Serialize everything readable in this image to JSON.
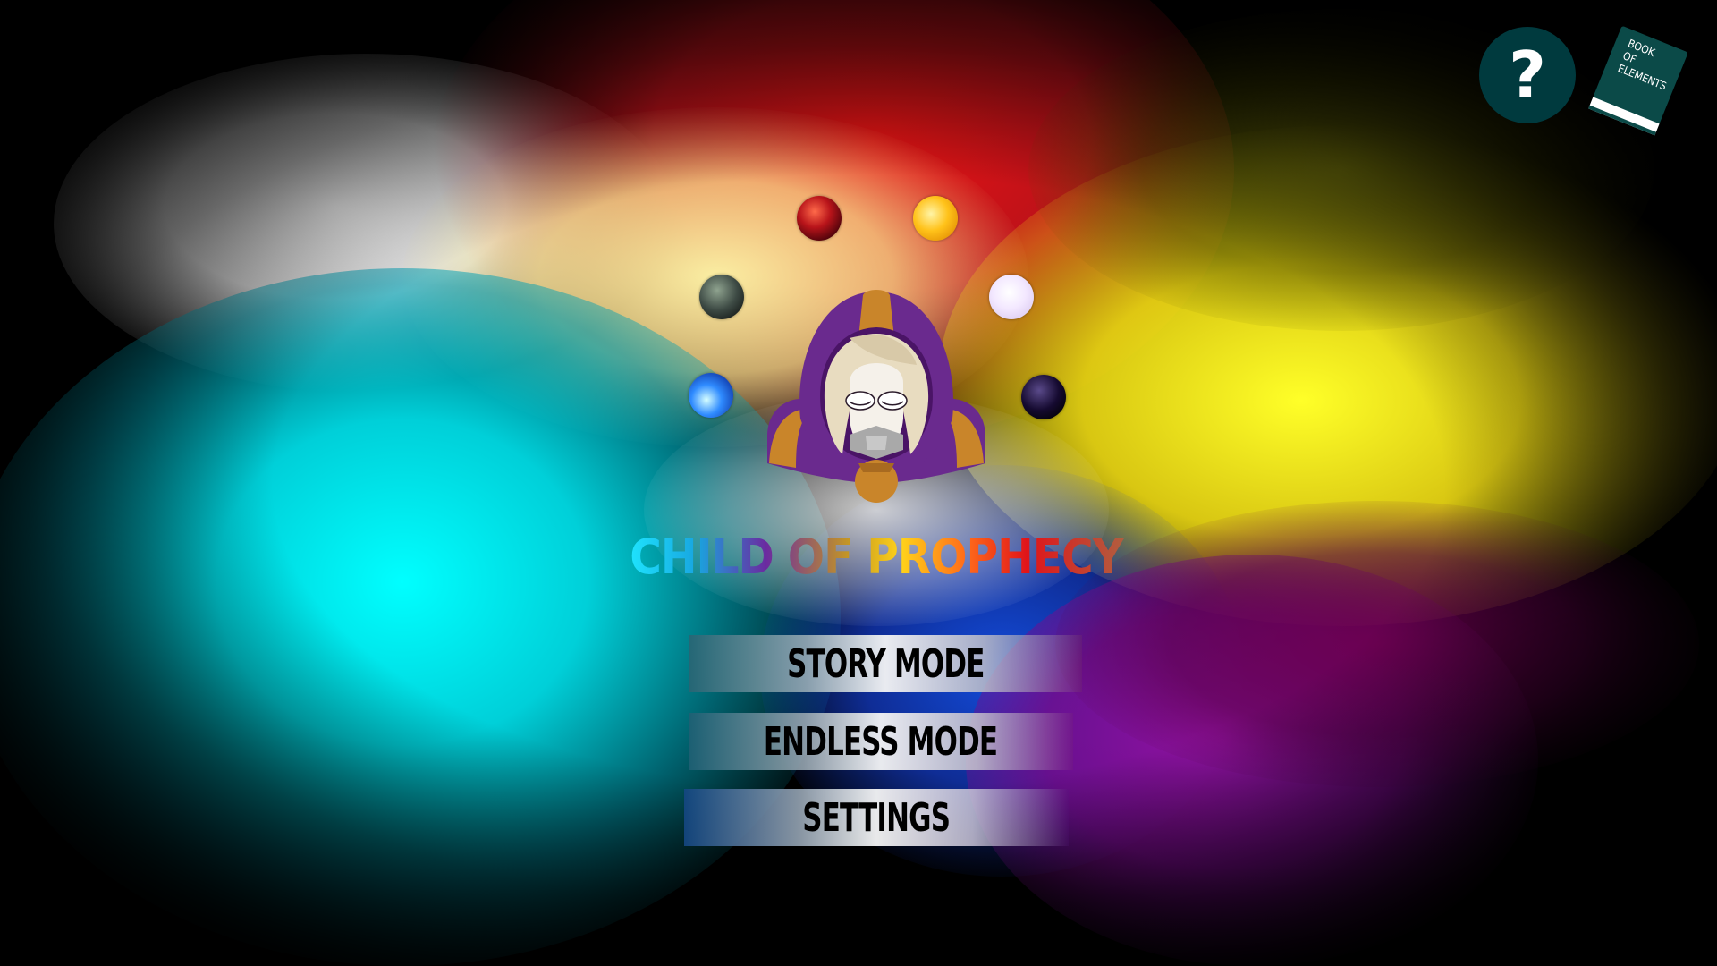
{
  "game": {
    "title": "CHILD OF PROPHECY"
  },
  "menu": {
    "story_mode": "STORY MODE",
    "endless_mode": "ENDLESS MODE",
    "settings": "SETTINGS"
  },
  "top_right": {
    "help_symbol": "?",
    "book_title_lines": [
      "BOOK",
      "OF",
      "ELEMENTS"
    ]
  },
  "orbs": [
    "fire",
    "light",
    "earth",
    "air",
    "water",
    "dark"
  ],
  "colors": {
    "button_dark_teal": "#003a3e",
    "book_cover": "#0b4a48",
    "hood_purple": "#6a2a8e",
    "trim_gold": "#c9852a"
  }
}
